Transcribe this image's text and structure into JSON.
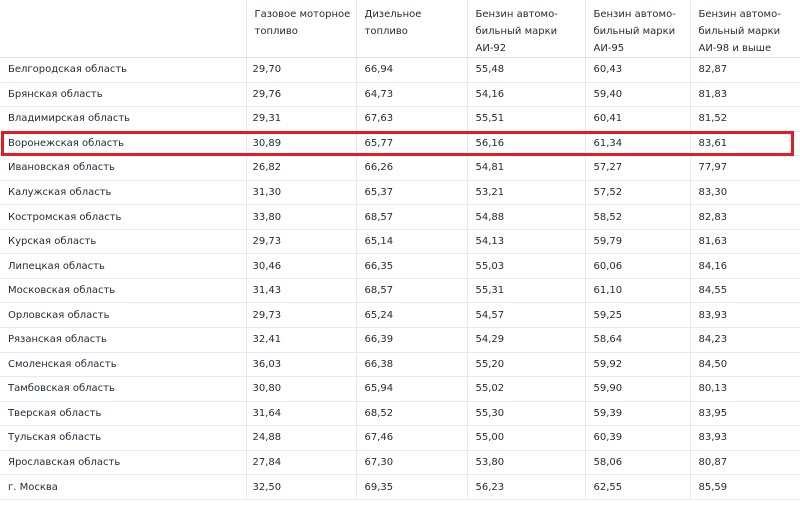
{
  "table": {
    "headers": [
      "",
      "Газовое моторное топливо",
      "Дизельное топливо",
      "Бензин автомо-бильный марки АИ-92",
      "Бензин автомо-бильный марки АИ-95",
      "Бензин автомо-бильный марки АИ-98 и выше"
    ],
    "rows": [
      [
        "Белгородская область",
        "29,70",
        "66,94",
        "55,48",
        "60,43",
        "82,87"
      ],
      [
        "Брянская область",
        "29,76",
        "64,73",
        "54,16",
        "59,40",
        "81,83"
      ],
      [
        "Владимирская область",
        "29,31",
        "67,63",
        "55,51",
        "60,41",
        "81,52"
      ],
      [
        "Воронежская область",
        "30,89",
        "65,77",
        "56,16",
        "61,34",
        "83,61"
      ],
      [
        "Ивановская область",
        "26,82",
        "66,26",
        "54,81",
        "57,27",
        "77,97"
      ],
      [
        "Калужская область",
        "31,30",
        "65,37",
        "53,21",
        "57,52",
        "83,30"
      ],
      [
        "Костромская область",
        "33,80",
        "68,57",
        "54,88",
        "58,52",
        "82,83"
      ],
      [
        "Курская область",
        "29,73",
        "65,14",
        "54,13",
        "59,79",
        "81,63"
      ],
      [
        "Липецкая область",
        "30,46",
        "66,35",
        "55,03",
        "60,06",
        "84,16"
      ],
      [
        "Московская область",
        "31,43",
        "68,57",
        "55,31",
        "61,10",
        "84,55"
      ],
      [
        "Орловская область",
        "29,73",
        "65,24",
        "54,57",
        "59,25",
        "83,93"
      ],
      [
        "Рязанская область",
        "32,41",
        "66,39",
        "54,29",
        "58,64",
        "84,23"
      ],
      [
        "Смоленская область",
        "36,03",
        "66,38",
        "55,20",
        "59,92",
        "84,50"
      ],
      [
        "Тамбовская область",
        "30,80",
        "65,94",
        "55,02",
        "59,90",
        "80,13"
      ],
      [
        "Тверская область",
        "31,64",
        "68,52",
        "55,30",
        "59,39",
        "83,95"
      ],
      [
        "Тульская область",
        "24,88",
        "67,46",
        "55,00",
        "60,39",
        "83,93"
      ],
      [
        "Ярославская область",
        "27,84",
        "67,30",
        "53,80",
        "58,06",
        "80,87"
      ],
      [
        "г. Москва",
        "32,50",
        "69,35",
        "56,23",
        "62,55",
        "85,59"
      ]
    ],
    "highlighted_row": "Воронежская область"
  },
  "colors": {
    "highlight_border": "#e11d24",
    "grid_line": "#e6e9ed",
    "text": "#1f2937"
  }
}
